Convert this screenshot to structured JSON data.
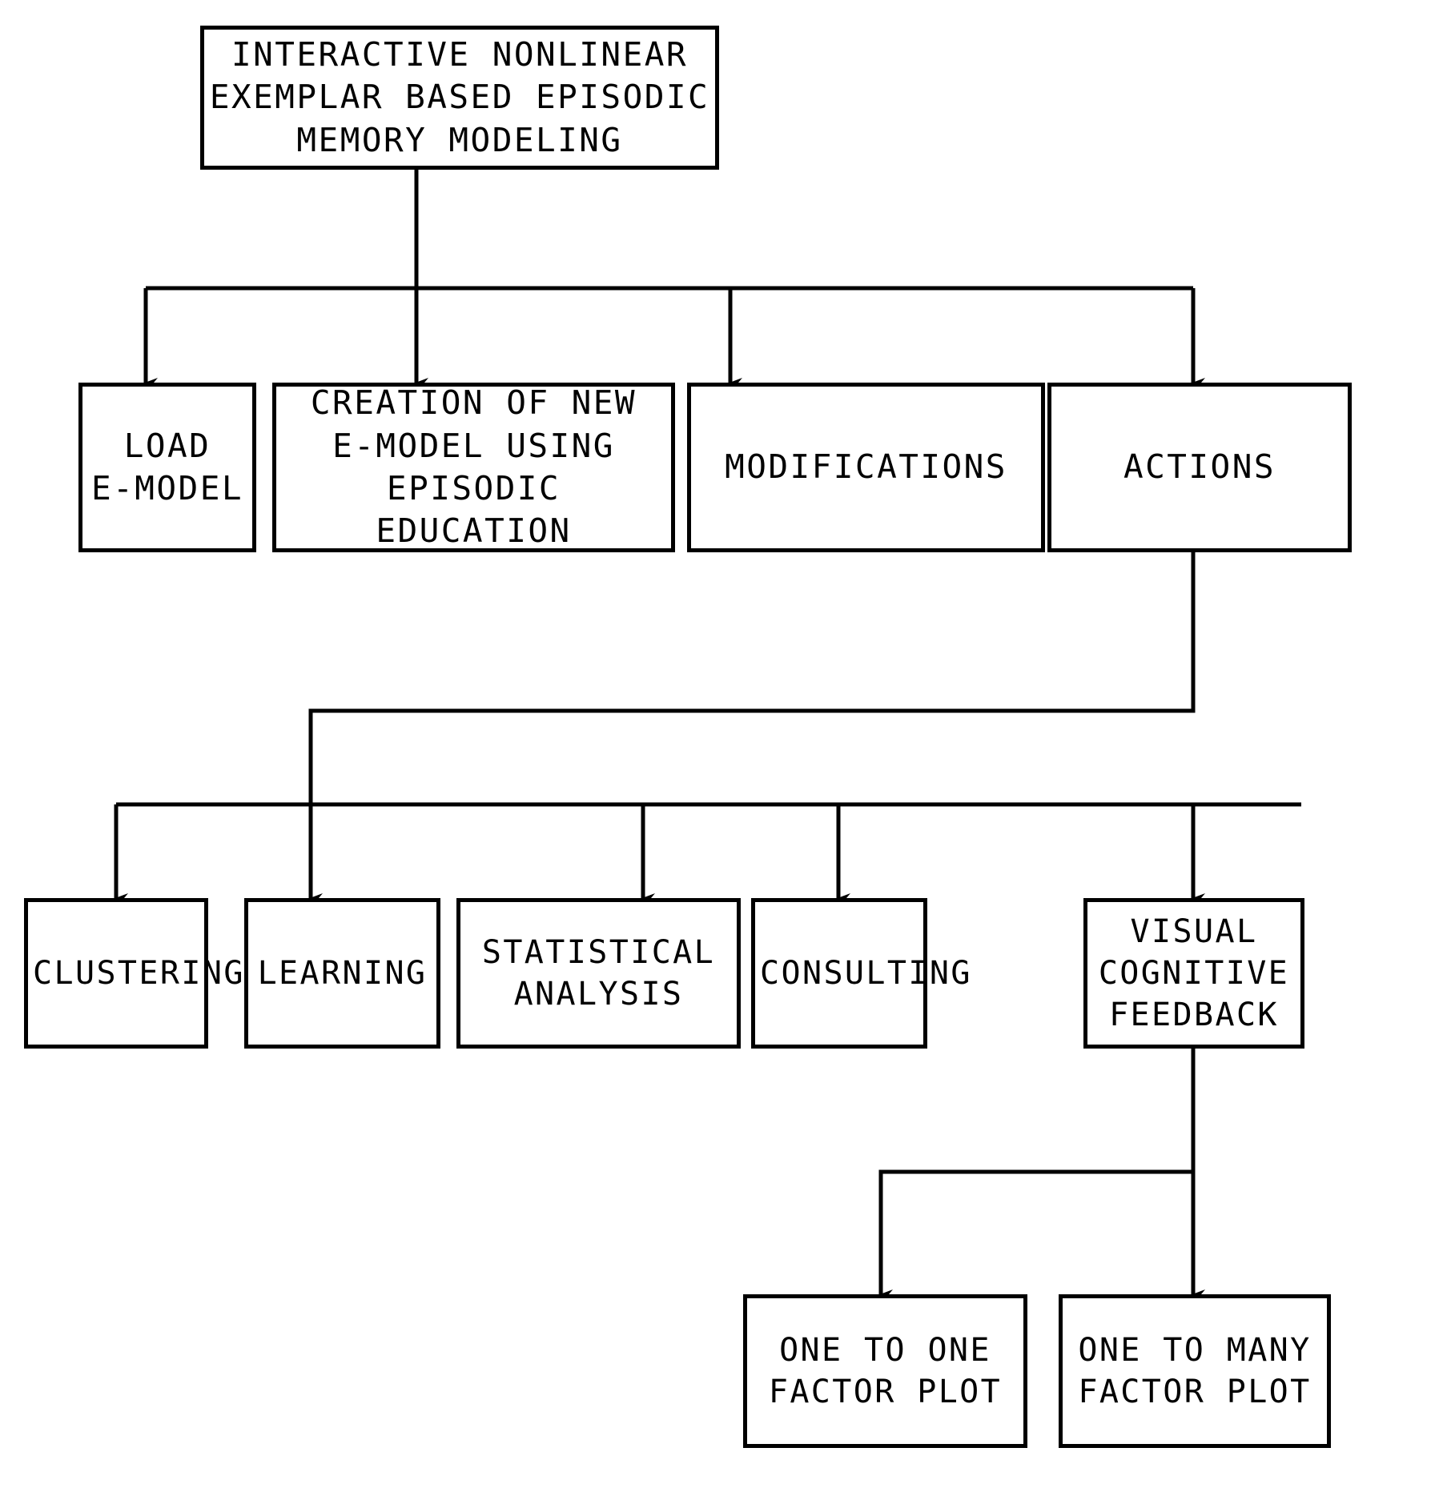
{
  "diagram": {
    "type": "flowchart",
    "title": "INTERACTIVE NONLINEAR EXEMPLAR BASED EPISODIC MEMORY MODELING",
    "background_color": "#ffffff",
    "line_color": "#000000",
    "text_color": "#000000",
    "nodes": {
      "root": {
        "label": "INTERACTIVE NONLINEAR\nEXEMPLAR BASED EPISODIC\nMEMORY MODELING"
      },
      "load_e_model": {
        "label": "LOAD\nE-MODEL"
      },
      "creation": {
        "label": "CREATION OF NEW\nE-MODEL USING\nEPISODIC EDUCATION"
      },
      "modifications": {
        "label": "MODIFICATIONS"
      },
      "actions": {
        "label": "ACTIONS"
      },
      "clustering": {
        "label": "CLUSTERING"
      },
      "learning": {
        "label": "LEARNING"
      },
      "statistical_analysis": {
        "label": "STATISTICAL\nANALYSIS"
      },
      "consulting": {
        "label": "CONSULTING"
      },
      "visual_cognitive_feedback": {
        "label": "VISUAL\nCOGNITIVE\nFEEDBACK"
      },
      "one_to_one_factor_plot": {
        "label": "ONE TO ONE\nFACTOR PLOT"
      },
      "one_to_many_factor_plot": {
        "label": "ONE TO MANY\nFACTOR PLOT"
      }
    },
    "edges": [
      {
        "from": "root",
        "to": "load_e_model"
      },
      {
        "from": "root",
        "to": "creation"
      },
      {
        "from": "root",
        "to": "modifications"
      },
      {
        "from": "root",
        "to": "actions"
      },
      {
        "from": "actions",
        "to": "clustering"
      },
      {
        "from": "actions",
        "to": "learning"
      },
      {
        "from": "actions",
        "to": "statistical_analysis"
      },
      {
        "from": "actions",
        "to": "consulting"
      },
      {
        "from": "actions",
        "to": "visual_cognitive_feedback"
      },
      {
        "from": "visual_cognitive_feedback",
        "to": "one_to_one_factor_plot"
      },
      {
        "from": "visual_cognitive_feedback",
        "to": "one_to_many_factor_plot"
      }
    ]
  }
}
